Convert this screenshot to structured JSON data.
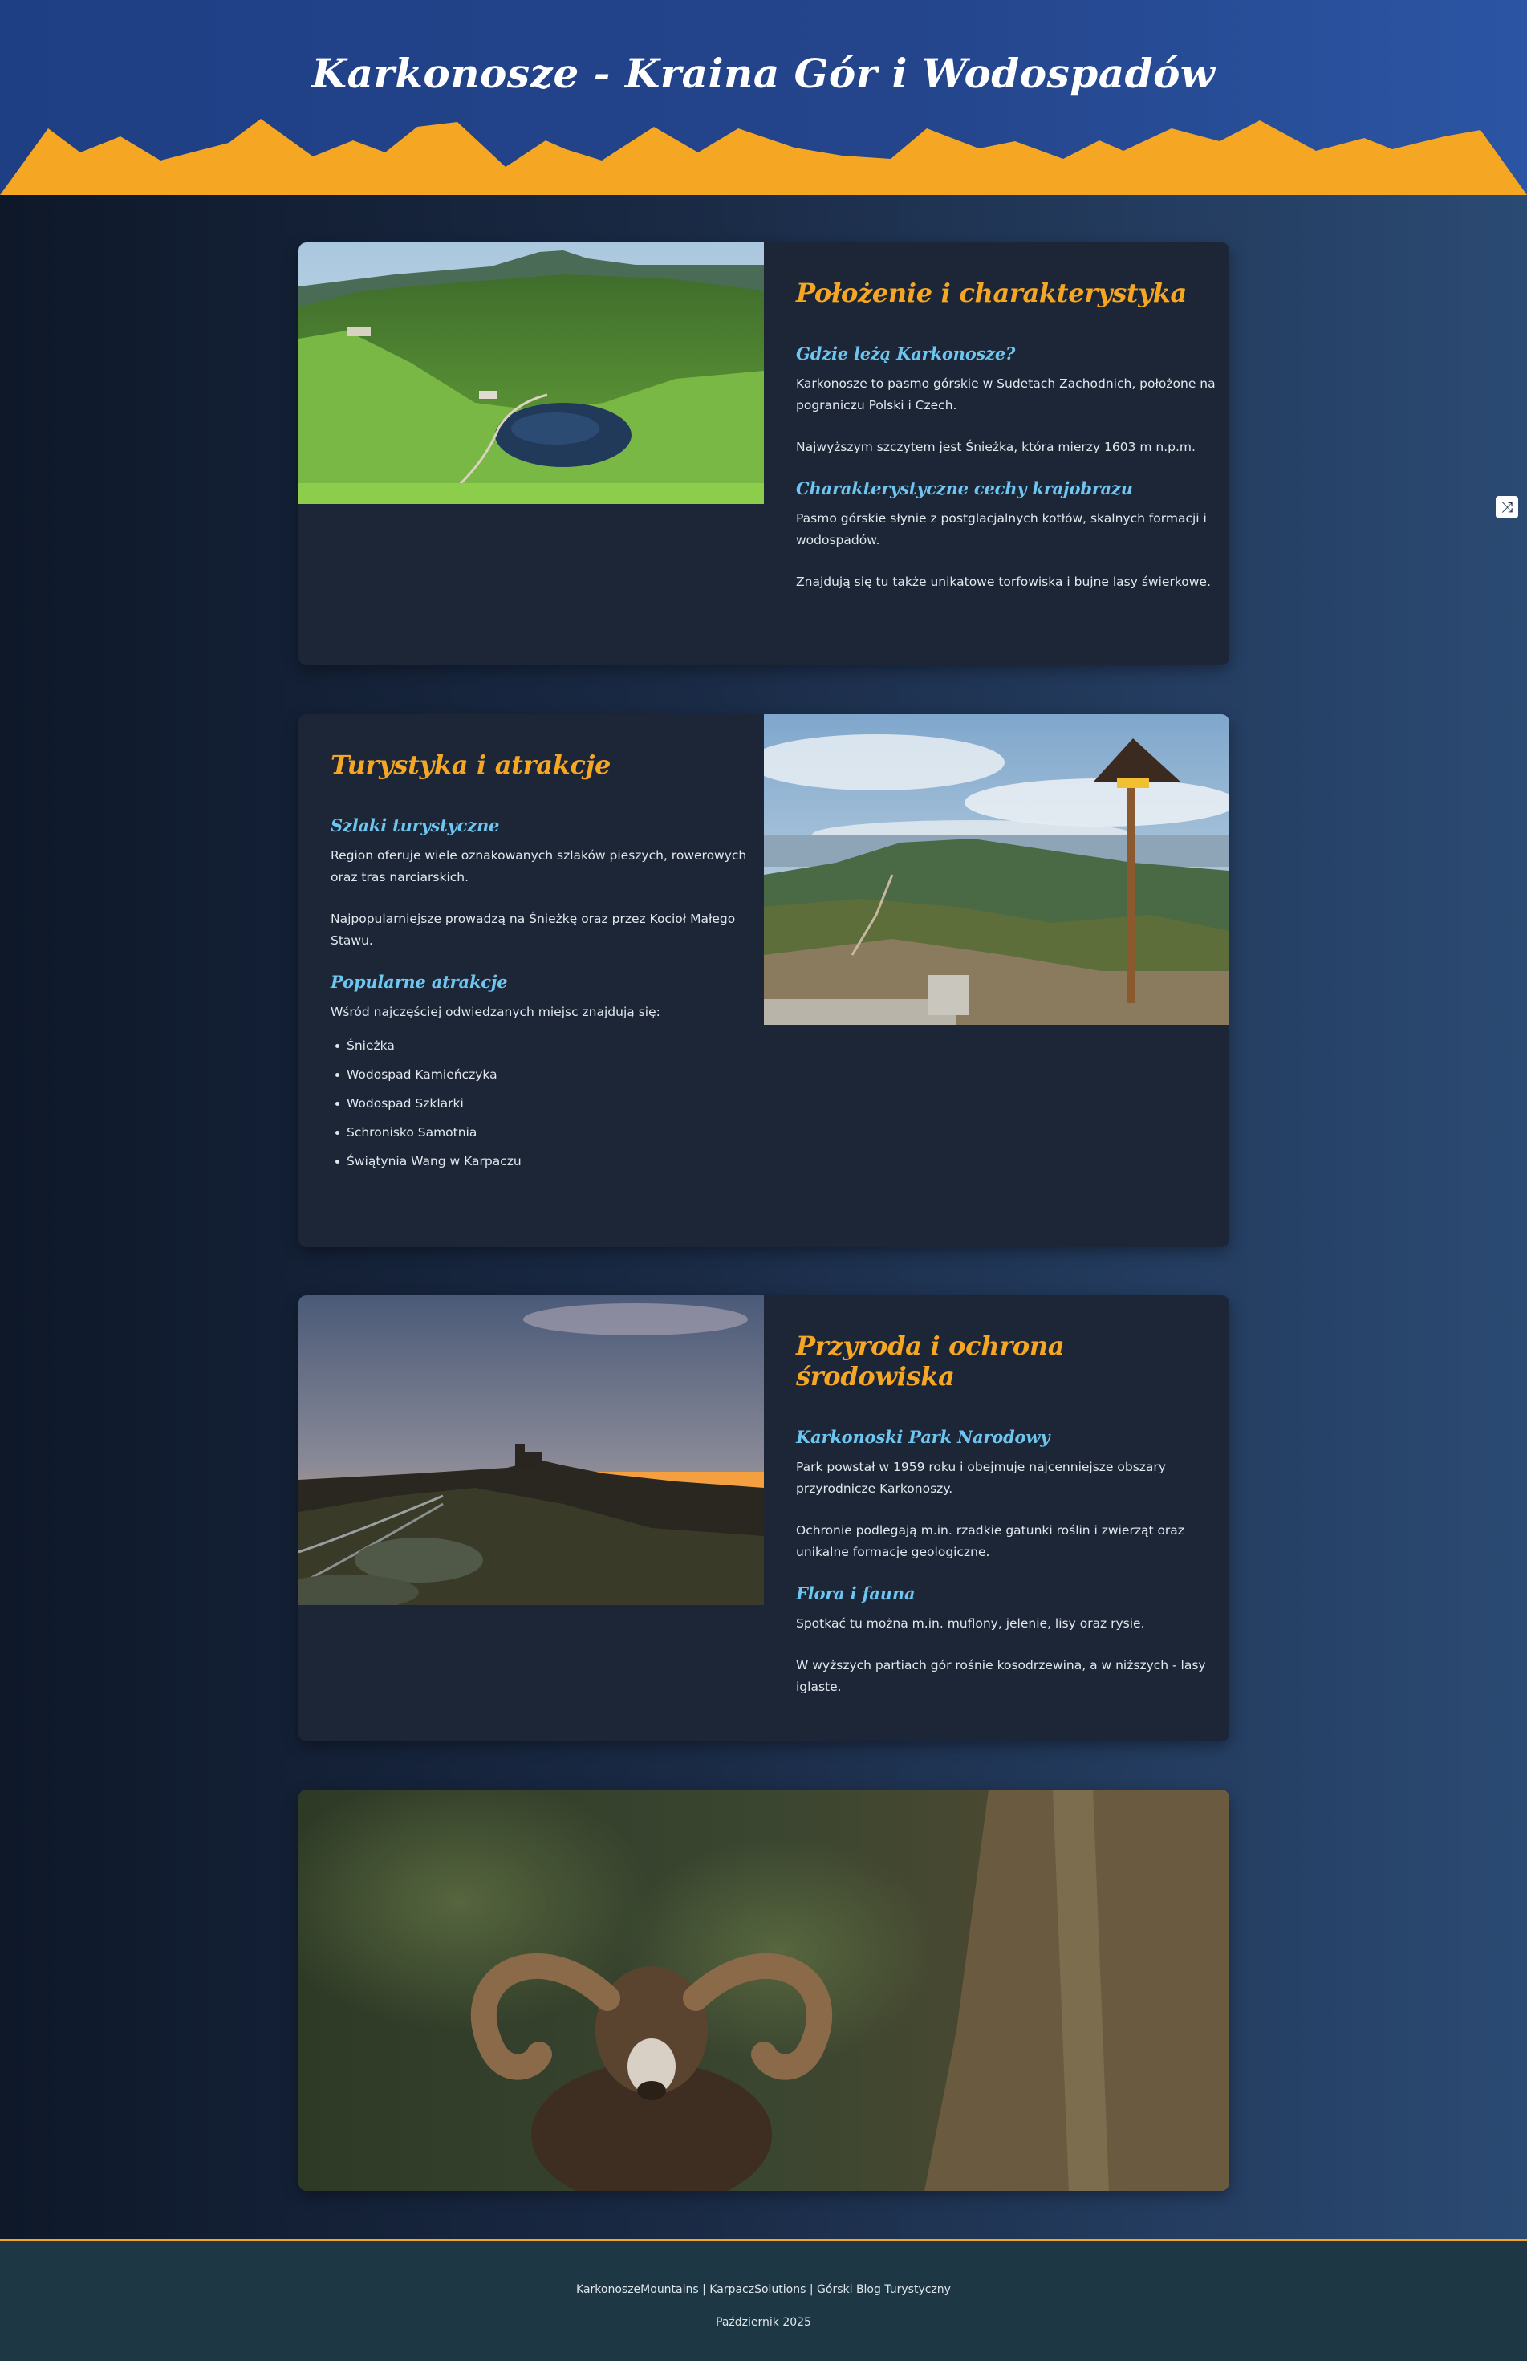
{
  "header": {
    "title": "Karkonosze - Kraina Gór i Wodospadów"
  },
  "sections": [
    {
      "title": "Położenie i charakterystyka",
      "subsections": [
        {
          "heading": "Gdzie leżą Karkonosze?",
          "paragraphs": [
            "Karkonosze to pasmo górskie w Sudetach Zachodnich, położone na pograniczu Polski i Czech.",
            "Najwyższym szczytem jest Śnieżka, która mierzy 1603 m n.p.m."
          ]
        },
        {
          "heading": "Charakterystyczne cechy krajobrazu",
          "paragraphs": [
            "Pasmo górskie słynie z postglacjalnych kotłów, skalnych formacji i wodospadów.",
            "Znajdują się tu także unikatowe torfowiska i bujne lasy świerkowe."
          ]
        }
      ],
      "image": "mountain-lake-photo"
    },
    {
      "title": "Turystyka i atrakcje",
      "subsections": [
        {
          "heading": "Szlaki turystyczne",
          "paragraphs": [
            "Region oferuje wiele oznakowanych szlaków pieszych, rowerowych oraz tras narciarskich.",
            "Najpopularniejsze prowadzą na Śnieżkę oraz przez Kocioł Małego Stawu."
          ]
        },
        {
          "heading": "Popularne atrakcje",
          "paragraphs": [
            "Wśród najczęściej odwiedzanych miejsc znajdują się:"
          ],
          "list": [
            "Śnieżka",
            "Wodospad Kamieńczyka",
            "Wodospad Szklarki",
            "Schronisko Samotnia",
            "Świątynia Wang w Karpaczu"
          ]
        }
      ],
      "image": "trail-signpost-photo"
    },
    {
      "title": "Przyroda i ochrona środowiska",
      "subsections": [
        {
          "heading": "Karkonoski Park Narodowy",
          "paragraphs": [
            "Park powstał w 1959 roku i obejmuje najcenniejsze obszary przyrodnicze Karkonoszy.",
            "Ochronie podlegają m.in. rzadkie gatunki roślin i zwierząt oraz unikalne formacje geologiczne."
          ]
        },
        {
          "heading": "Flora i fauna",
          "paragraphs": [
            "Spotkać tu można m.in. muflony, jelenie, lisy oraz rysie.",
            "W wyższych partiach gór rośnie kosodrzewina, a w niższych - lasy iglaste."
          ]
        }
      ],
      "image": "sunset-ridge-photo"
    }
  ],
  "wide_image": "mouflon-photo",
  "shuffle_icon": "shuffle-icon",
  "footer": {
    "line1": "KarkonoszeMountains | KarpaczSolutions | Górski Blog Turystyczny",
    "line2": "Październik 2025"
  },
  "colors": {
    "accent": "#f5a623",
    "subheading": "#6ec6f0",
    "header_bg": "#24458c",
    "card_bg": "#1c2636"
  }
}
